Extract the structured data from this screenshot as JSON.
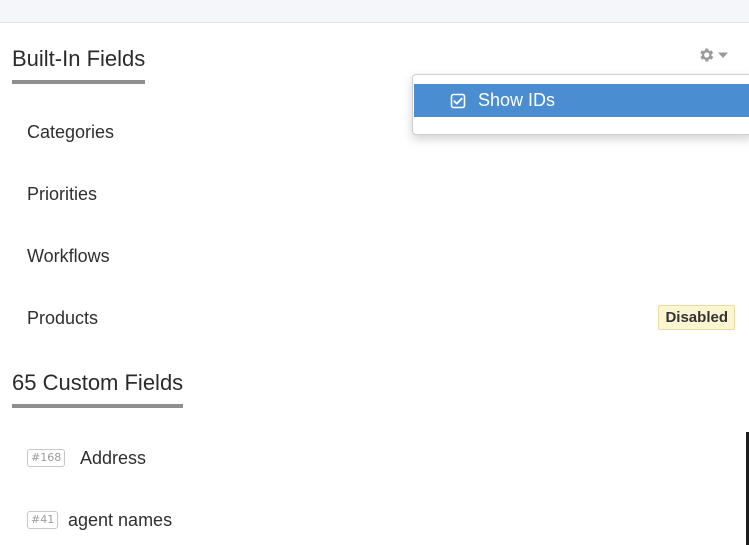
{
  "builtin_section": {
    "title": "Built-In Fields",
    "items": [
      {
        "label": "Categories"
      },
      {
        "label": "Priorities"
      },
      {
        "label": "Workflows"
      },
      {
        "label": "Products",
        "badge": "Disabled"
      }
    ]
  },
  "custom_section": {
    "title": "65 Custom Fields",
    "items": [
      {
        "id": "#168",
        "label": "Address"
      },
      {
        "id": "#41",
        "label": "agent names"
      }
    ]
  },
  "settings_menu": {
    "gear_icon": "gear-icon",
    "caret_icon": "caret-down-icon",
    "items": [
      {
        "label": "Show IDs",
        "checked": true,
        "icon": "checkbox-checked-icon"
      }
    ]
  },
  "colors": {
    "menu_highlight": "#4a8dd1",
    "badge_background": "#fcf5d2",
    "title_underline": "#8f8f8f"
  }
}
